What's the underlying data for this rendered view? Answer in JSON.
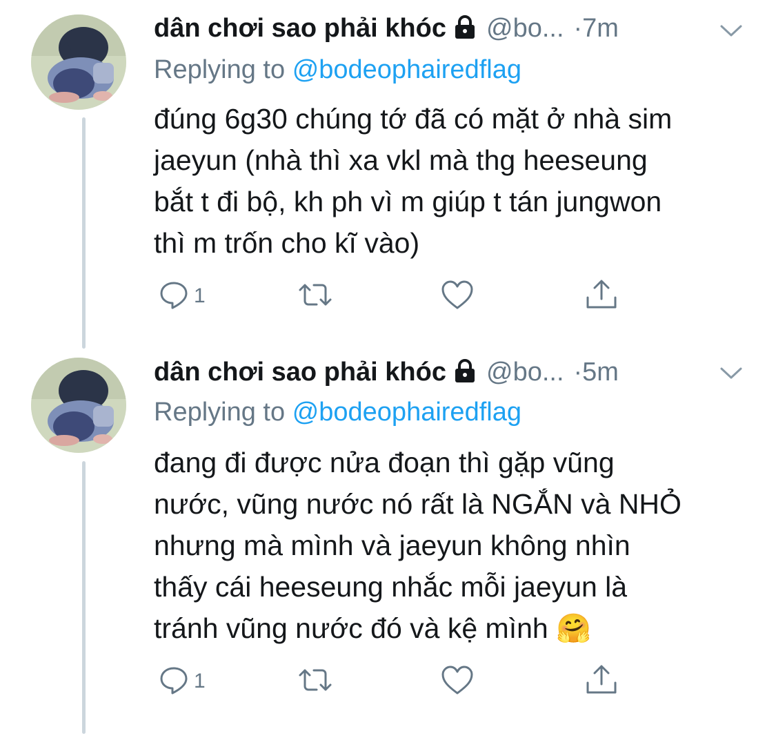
{
  "tweets": [
    {
      "display_name": "dân chơi sao phải khóc",
      "handle": "@bo...",
      "separator": "·",
      "time": "7m",
      "replying_prefix": "Replying to",
      "replying_to": "@bodeophairedflag",
      "lines": [
        "đúng 6g30 chúng tớ đã có mặt ở nhà sim",
        "jaeyun (nhà thì xa vkl mà thg heeseung",
        "bắt t đi bộ, kh ph vì m giúp t tán jungwon",
        "thì m trốn cho kĩ vào)"
      ],
      "reply_count": "1"
    },
    {
      "display_name": "dân chơi sao phải khóc",
      "handle": "@bo...",
      "separator": "·",
      "time": "5m",
      "replying_prefix": "Replying to",
      "replying_to": "@bodeophairedflag",
      "lines": [
        "đang đi được nửa đoạn thì gặp vũng",
        "nước, vũng nước nó rất là NGẮN và NHỎ",
        "nhưng mà mình và jaeyun không nhìn",
        "thấy cái heeseung nhắc mỗi jaeyun là",
        "tránh vũng nước đó và kệ mình 🤗"
      ],
      "reply_count": "1"
    }
  ],
  "colors": {
    "text": "#14171a",
    "muted": "#657786",
    "link": "#1da1f2",
    "thread": "#ccd6dd"
  },
  "icons": [
    "lock-icon",
    "chevron-down-icon",
    "reply-icon",
    "retweet-icon",
    "like-icon",
    "share-icon"
  ]
}
